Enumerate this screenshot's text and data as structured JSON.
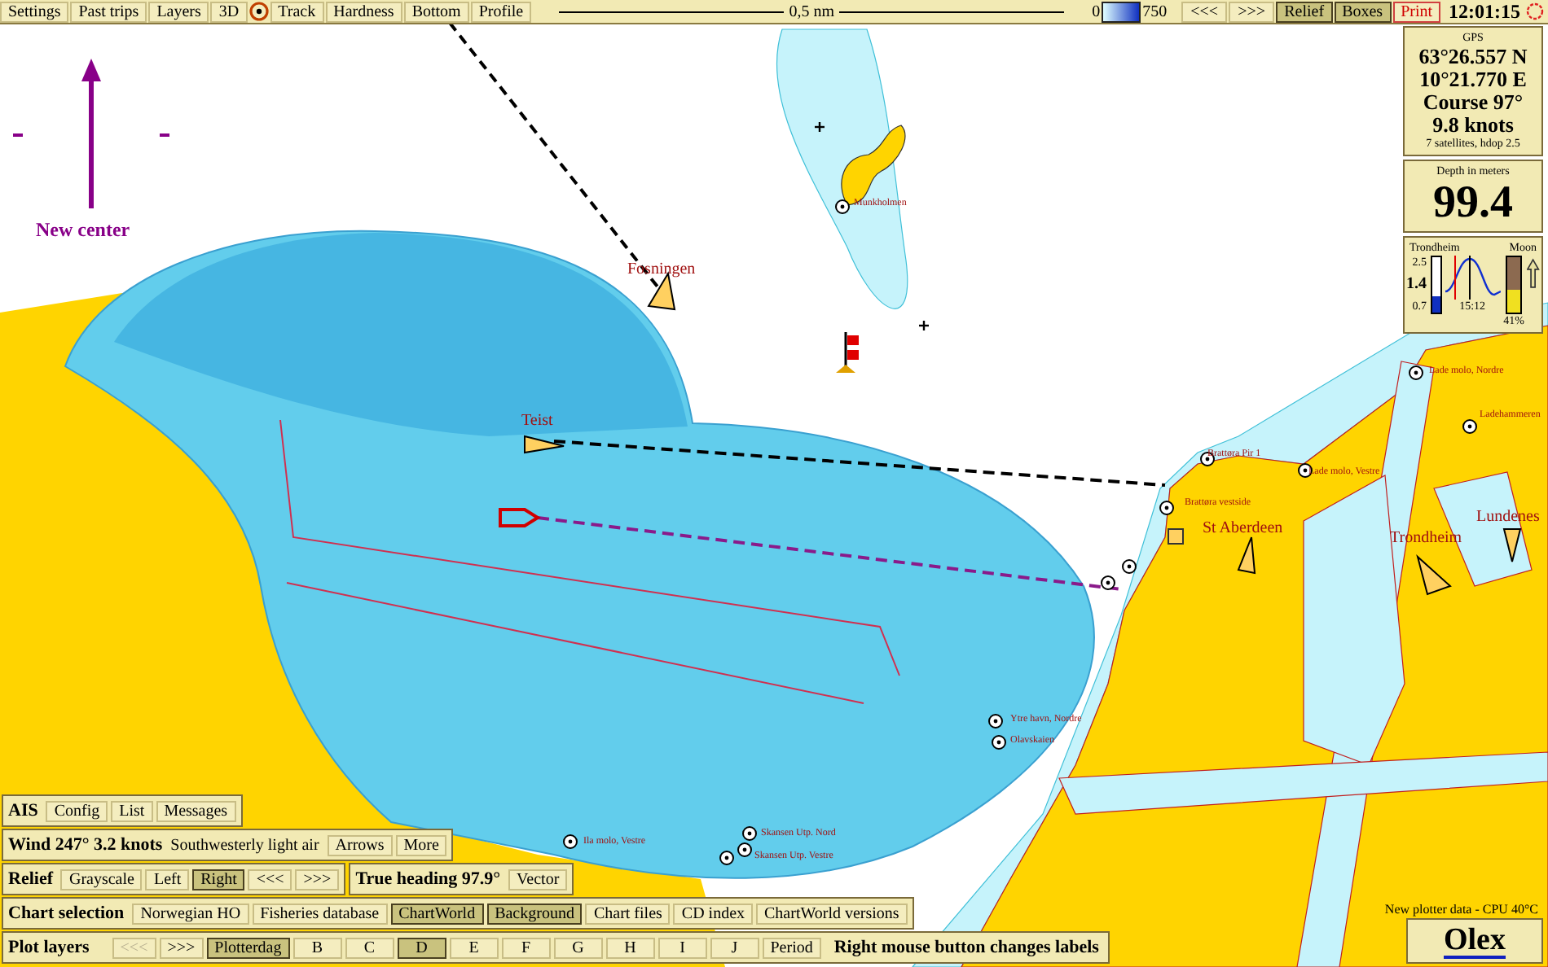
{
  "top_toolbar": {
    "items": [
      {
        "kind": "button",
        "label": "Settings"
      },
      {
        "kind": "button",
        "label": "Past trips"
      },
      {
        "kind": "button",
        "label": "Layers"
      },
      {
        "kind": "button",
        "label": "3D"
      },
      {
        "kind": "target"
      },
      {
        "kind": "button",
        "label": "Track"
      },
      {
        "kind": "button",
        "label": "Hardness"
      },
      {
        "kind": "button",
        "label": "Bottom"
      },
      {
        "kind": "button",
        "label": "Profile"
      }
    ],
    "scale_bar": {
      "label": "0,5 nm"
    },
    "depth_legend": {
      "min": "0",
      "max": "750"
    },
    "right_items": [
      {
        "kind": "button",
        "label": "<<<",
        "selected": false
      },
      {
        "kind": "button",
        "label": ">>>",
        "selected": false
      },
      {
        "kind": "button",
        "label": "Relief",
        "selected": true
      },
      {
        "kind": "button",
        "label": "Boxes",
        "selected": true
      },
      {
        "kind": "alert",
        "label": "Print",
        "selected": false
      }
    ],
    "clock": "12:01:15"
  },
  "new_center": {
    "label": "New center"
  },
  "map_labels": [
    {
      "kind": "place",
      "text": "Fosningen"
    },
    {
      "kind": "place",
      "text": "Teist"
    },
    {
      "kind": "small",
      "text": "Munkholmen"
    },
    {
      "kind": "small",
      "text": "Brattøra Pir 1"
    },
    {
      "kind": "small",
      "text": "Brattøra vestside"
    },
    {
      "kind": "small",
      "text": "Lade molo, Vestre"
    },
    {
      "kind": "small",
      "text": "Lade molo, Nordre"
    },
    {
      "kind": "small",
      "text": "Ladehammeren"
    },
    {
      "kind": "place",
      "text": "St Aberdeen"
    },
    {
      "kind": "place",
      "text": "Trondheim"
    },
    {
      "kind": "place",
      "text": "Lundenes"
    },
    {
      "kind": "small",
      "text": "Ytre havn, Nordre"
    },
    {
      "kind": "small",
      "text": "Olavskaien"
    },
    {
      "kind": "small",
      "text": "Ila molo, Vestre"
    },
    {
      "kind": "small",
      "text": "Skansen Utp. Nord"
    },
    {
      "kind": "small",
      "text": "Skansen Utp. Vestre"
    }
  ],
  "gps": {
    "title": "GPS",
    "latitude": "63°26.557 N",
    "longitude": "10°21.770 E",
    "course": "Course 97°",
    "speed": "9.8 knots",
    "satellites": "7 satellites, hdop 2.5"
  },
  "depth": {
    "title": "Depth in meters",
    "value": "99.4"
  },
  "tide": {
    "place": "Trondheim",
    "high": "2.5",
    "current": "1.4",
    "low": "0.7",
    "time": "15:12",
    "level": 0.3,
    "moon": {
      "label": "Moon",
      "level": 0.41,
      "percent": "41%"
    }
  },
  "ais": {
    "title": "AIS",
    "buttons": [
      "Config",
      "List",
      "Messages"
    ]
  },
  "wind": {
    "reading": "Wind 247° 3.2 knots",
    "description": "Southwesterly light air",
    "buttons": [
      "Arrows",
      "More"
    ]
  },
  "relief": {
    "title": "Relief",
    "buttons": [
      {
        "label": "Grayscale",
        "selected": false
      },
      {
        "label": "Left",
        "selected": false
      },
      {
        "label": "Right",
        "selected": true
      },
      {
        "label": "<<<",
        "selected": false
      },
      {
        "label": ">>>",
        "selected": false
      }
    ]
  },
  "heading": {
    "reading": "True heading 97.9°",
    "buttons": [
      "Vector"
    ]
  },
  "chart_selection": {
    "title": "Chart selection",
    "buttons": [
      {
        "label": "Norwegian HO",
        "selected": false
      },
      {
        "label": "Fisheries database",
        "selected": false
      },
      {
        "label": "ChartWorld",
        "selected": true
      },
      {
        "label": "Background",
        "selected": true
      },
      {
        "label": "Chart files",
        "selected": false
      },
      {
        "label": "CD index",
        "selected": false
      },
      {
        "label": "ChartWorld versions",
        "selected": false
      }
    ]
  },
  "plot_layers": {
    "title": "Plot layers",
    "buttons": [
      {
        "label": "<<<",
        "selected": false,
        "disabled": true
      },
      {
        "label": ">>>",
        "selected": false,
        "disabled": false
      },
      {
        "label": "Plotterdag",
        "selected": true,
        "disabled": false
      },
      {
        "label": "B",
        "selected": false,
        "disabled": false
      },
      {
        "label": "C",
        "selected": false,
        "disabled": false
      },
      {
        "label": "D",
        "selected": true,
        "disabled": false
      },
      {
        "label": "E",
        "selected": false,
        "disabled": false
      },
      {
        "label": "F",
        "selected": false,
        "disabled": false
      },
      {
        "label": "G",
        "selected": false,
        "disabled": false
      },
      {
        "label": "H",
        "selected": false,
        "disabled": false
      },
      {
        "label": "I",
        "selected": false,
        "disabled": false
      },
      {
        "label": "J",
        "selected": false,
        "disabled": false
      },
      {
        "label": "Period",
        "selected": false,
        "disabled": false
      }
    ],
    "hint": "Right mouse button changes labels"
  },
  "status": "New plotter data - CPU 40°C",
  "logo": "Olex"
}
